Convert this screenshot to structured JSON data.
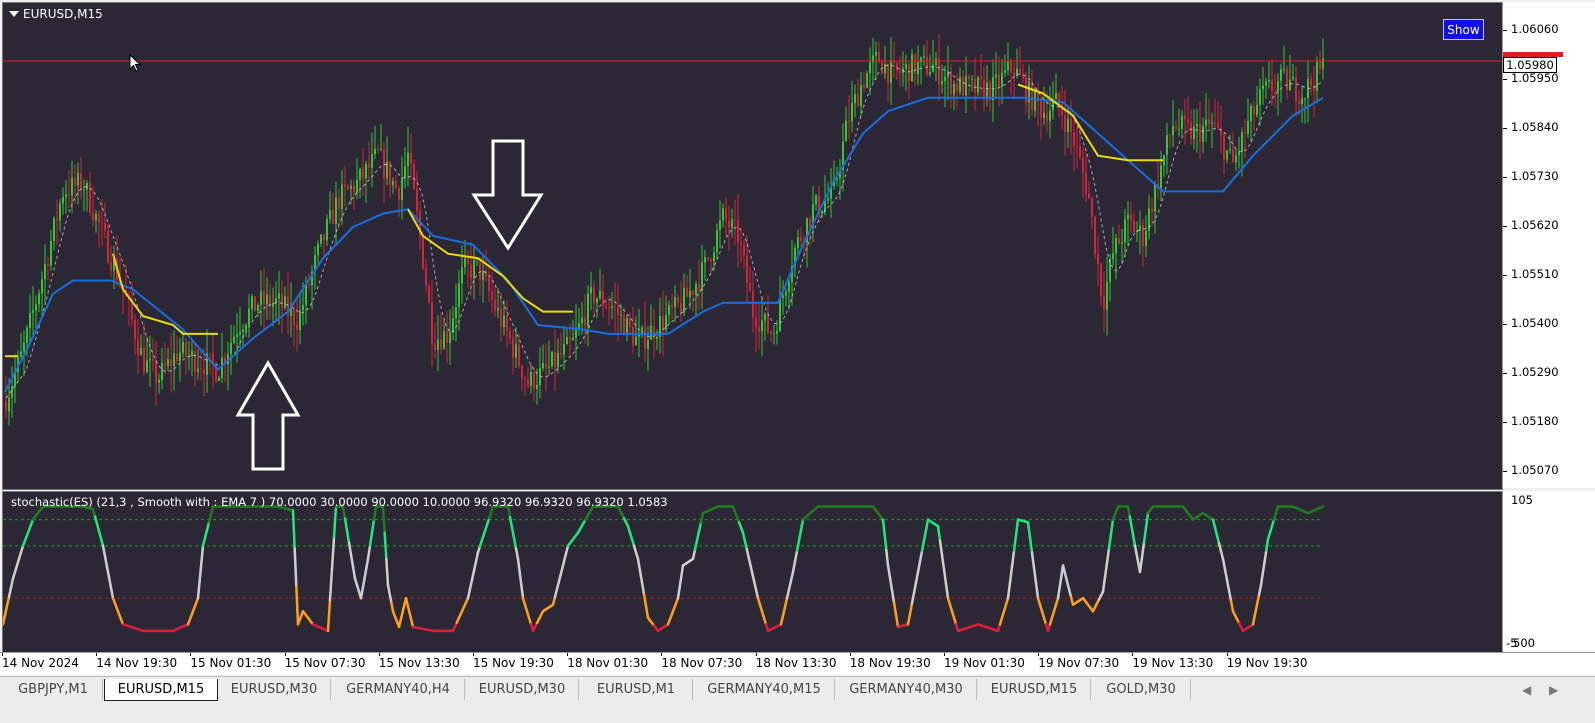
{
  "chart": {
    "title": "EURUSD,M15",
    "show_button": "Show",
    "current_price": "1.05980",
    "price_labels": [
      "1.06060",
      "1.05950",
      "1.05840",
      "1.05730",
      "1.05620",
      "1.05510",
      "1.05400",
      "1.05290",
      "1.05180",
      "1.05070"
    ],
    "colors": {
      "background": "#2b2735",
      "bull_candle": "#34c634",
      "bear_candle": "#d3243c",
      "blue_line": "#1a6fe0",
      "yellow_line": "#e8dc14",
      "price_line": "#e01e1e",
      "arrows": "#ffffff"
    },
    "arrows": [
      {
        "direction": "up",
        "icon": "up-arrow-icon"
      },
      {
        "direction": "down",
        "icon": "down-arrow-icon"
      }
    ]
  },
  "indicator": {
    "label": "stochastic(ES) (21,3 , Smooth with : EMA  7 ) 70.0000 30.0000 90.0000 10.0000 96.9320 96.9320 96.9320 1.0583",
    "axis_top": "105",
    "axis_bottom": "-5",
    "axis_bottom_overlap": "500",
    "levels": [
      90,
      70,
      30,
      10
    ],
    "colors": {
      "high": "#1e7d1e",
      "upper": "#22e87c",
      "mid": "#cfcfcf",
      "lower": "#ffa01e",
      "low": "#dd1e3c"
    }
  },
  "time_labels": [
    "14 Nov 2024",
    "14 Nov 19:30",
    "15 Nov 01:30",
    "15 Nov 07:30",
    "15 Nov 13:30",
    "15 Nov 19:30",
    "18 Nov 01:30",
    "18 Nov 07:30",
    "18 Nov 13:30",
    "18 Nov 19:30",
    "19 Nov 01:30",
    "19 Nov 07:30",
    "19 Nov 13:30",
    "19 Nov 19:30"
  ],
  "tabs": [
    {
      "label": "GBPJPY,M1",
      "active": false
    },
    {
      "label": "EURUSD,M15",
      "active": true
    },
    {
      "label": "EURUSD,M30",
      "active": false
    },
    {
      "label": "GERMANY40,H4",
      "active": false
    },
    {
      "label": "EURUSD,M30",
      "active": false
    },
    {
      "label": "EURUSD,M1",
      "active": false
    },
    {
      "label": "GERMANY40,M15",
      "active": false
    },
    {
      "label": "GERMANY40,M30",
      "active": false
    },
    {
      "label": "EURUSD,M15",
      "active": false
    },
    {
      "label": "GOLD,M30",
      "active": false
    }
  ],
  "nav": {
    "left_arrow": "◀",
    "right_arrow": "▶"
  }
}
